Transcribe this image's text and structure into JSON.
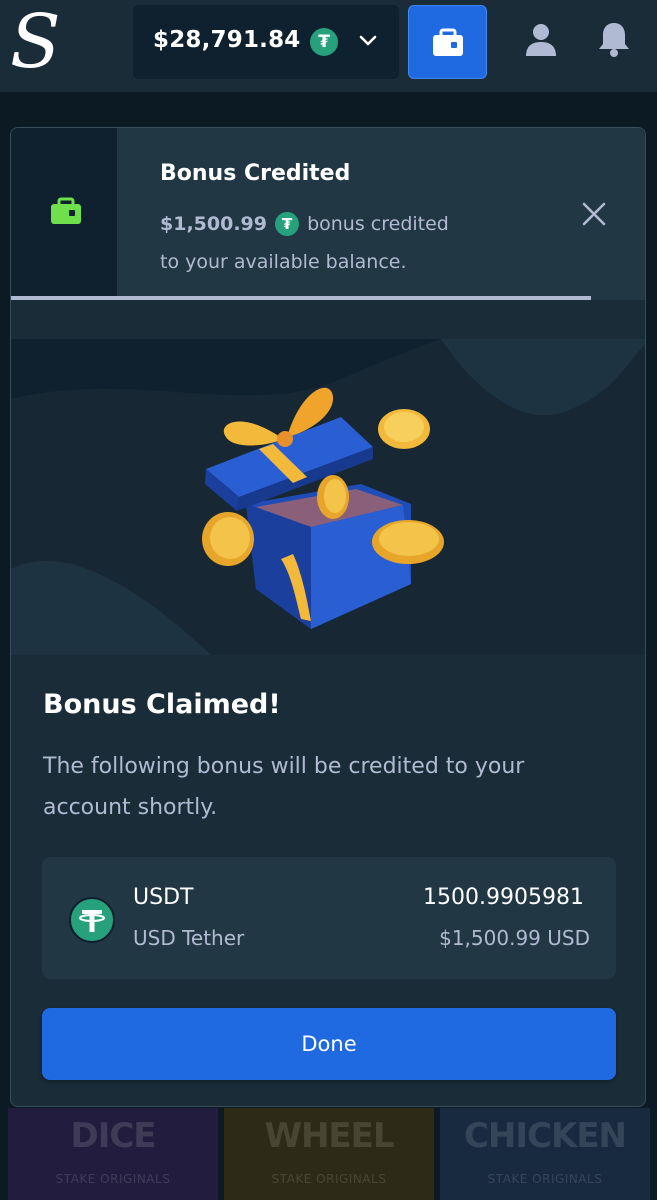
{
  "header": {
    "logo_letter": "S",
    "balance": "$28,791.84",
    "currency_symbol": "₮",
    "icons": [
      "stake-logo",
      "tether-icon",
      "chevron-down-icon",
      "wallet-icon",
      "user-icon",
      "bell-icon"
    ]
  },
  "toast": {
    "title": "Bonus Credited",
    "amount": "$1,500.99",
    "message_part1": "bonus credited",
    "message_part2": "to your available balance.",
    "icons": [
      "wallet-icon",
      "close-icon"
    ],
    "accent_color": "#6fe04b"
  },
  "modal": {
    "title": "Bonus Claimed!",
    "description": "The following bonus will be credited to your account shortly.",
    "asset": {
      "symbol": "USDT",
      "name": "USD Tether",
      "amount": "1500.9905981",
      "usd_value": "$1,500.99 USD"
    },
    "done_label": "Done"
  },
  "background_tiles": [
    {
      "name": "DICE",
      "subtitle": "STAKE ORIGINALS"
    },
    {
      "name": "WHEEL",
      "subtitle": "STAKE ORIGINALS"
    },
    {
      "name": "CHICKEN",
      "subtitle": "STAKE ORIGINALS"
    }
  ],
  "colors": {
    "background": "#1a2c38",
    "panel": "#213743",
    "dark": "#0f212e",
    "primary_button": "#1f6ae0",
    "tether": "#26a17b",
    "muted_text": "#b1bad3"
  }
}
